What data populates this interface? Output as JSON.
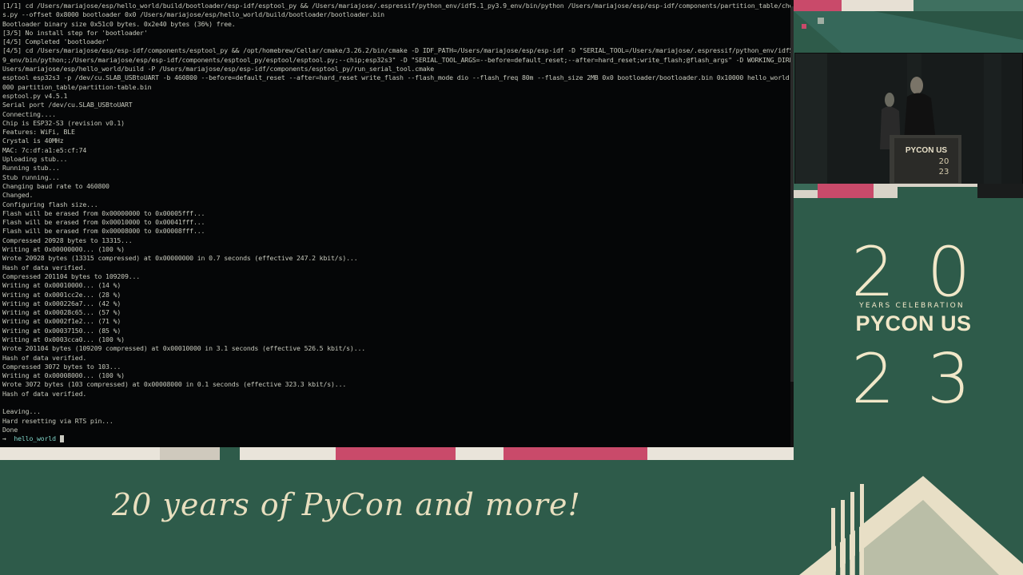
{
  "terminal": {
    "lines": [
      "[1/1] cd /Users/mariajose/esp/hello_world/build/bootloader/esp-idf/esptool_py && /Users/mariajose/.espressif/python_env/idf5.1_py3.9_env/bin/python /Users/mariajose/esp/esp-idf/components/partition_table/check_si",
      "s.py --offset 0x8000 bootloader 0x0 /Users/mariajose/esp/hello_world/build/bootloader/bootloader.bin",
      "Bootloader binary size 0x51c0 bytes. 0x2e40 bytes (36%) free.",
      "[3/5] No install step for 'bootloader'",
      "[4/5] Completed 'bootloader'",
      "[4/5] cd /Users/mariajose/esp/esp-idf/components/esptool_py && /opt/homebrew/Cellar/cmake/3.26.2/bin/cmake -D IDF_PATH=/Users/mariajose/esp/esp-idf -D \"SERIAL_TOOL=/Users/mariajose/.espressif/python_env/idf5.1_py",
      "9_env/bin/python;;/Users/mariajose/esp/esp-idf/components/esptool_py/esptool/esptool.py;--chip;esp32s3\" -D \"SERIAL_TOOL_ARGS=--before=default_reset;--after=hard_reset;write_flash;@flash_args\" -D WORKING_DIRECTORY=",
      "Users/mariajose/esp/hello_world/build -P /Users/mariajose/esp/esp-idf/components/esptool_py/run_serial_tool.cmake",
      "esptool esp32s3 -p /dev/cu.SLAB_USBtoUART -b 460800 --before=default_reset --after=hard_reset write_flash --flash_mode dio --flash_freq 80m --flash_size 2MB 0x0 bootloader/bootloader.bin 0x10000 hello_world.bin 0x",
      "000 partition_table/partition-table.bin",
      "esptool.py v4.5.1",
      "Serial port /dev/cu.SLAB_USBtoUART",
      "Connecting....",
      "Chip is ESP32-S3 (revision v0.1)",
      "Features: WiFi, BLE",
      "Crystal is 40MHz",
      "MAC: 7c:df:a1:e5:cf:74",
      "Uploading stub...",
      "Running stub...",
      "Stub running...",
      "Changing baud rate to 460800",
      "Changed.",
      "Configuring flash size...",
      "Flash will be erased from 0x00000000 to 0x00005fff...",
      "Flash will be erased from 0x00010000 to 0x00041fff...",
      "Flash will be erased from 0x00008000 to 0x00008fff...",
      "Compressed 20928 bytes to 13315...",
      "Writing at 0x00000000... (100 %)",
      "Wrote 20928 bytes (13315 compressed) at 0x00000000 in 0.7 seconds (effective 247.2 kbit/s)...",
      "Hash of data verified.",
      "Compressed 201104 bytes to 109209...",
      "Writing at 0x00010000... (14 %)",
      "Writing at 0x0001cc2e... (28 %)",
      "Writing at 0x000226a7... (42 %)",
      "Writing at 0x00028c65... (57 %)",
      "Writing at 0x0002f1e2... (71 %)",
      "Writing at 0x00037150... (85 %)",
      "Writing at 0x0003cca0... (100 %)",
      "Wrote 201104 bytes (109209 compressed) at 0x00010000 in 3.1 seconds (effective 526.5 kbit/s)...",
      "Hash of data verified.",
      "Compressed 3072 bytes to 103...",
      "Writing at 0x00008000... (100 %)",
      "Wrote 3072 bytes (103 compressed) at 0x00008000 in 0.1 seconds (effective 323.3 kbit/s)...",
      "Hash of data verified.",
      "",
      "Leaving...",
      "Hard resetting via RTS pin...",
      "Done"
    ],
    "prompt_arrow": "→",
    "prompt_dir": "hello_world"
  },
  "video": {
    "podium_text": "PYCON US",
    "podium_year_top": "20",
    "podium_year_bottom": "23"
  },
  "logo": {
    "num_top": "20",
    "years_text": "YEARS CELEBRATION",
    "brand": "PYCON US",
    "num_bottom": "23"
  },
  "banner": {
    "tagline": "20 years of PyCon and more!"
  },
  "colors": {
    "green": "#2e5b4a",
    "cream": "#f1e7c8",
    "pink": "#c94a6a",
    "terminal_bg": "#050607"
  }
}
